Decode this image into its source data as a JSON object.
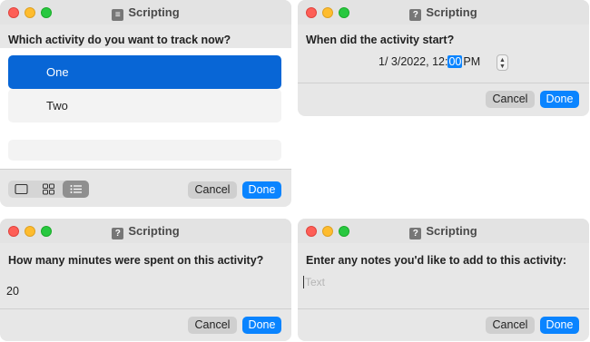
{
  "app_title": "Scripting",
  "title_icons": {
    "list": "list-icon",
    "question": "?"
  },
  "activity_dialog": {
    "prompt": "Which activity do you want to track now?",
    "items": [
      {
        "label": "One",
        "selected": true
      },
      {
        "label": "Two",
        "selected": false
      },
      {
        "label": "",
        "selected": false
      }
    ],
    "view_modes": [
      "single-view-icon",
      "grid-view-icon",
      "list-view-icon"
    ],
    "active_view": "list-view-icon",
    "cancel_label": "Cancel",
    "done_label": "Done"
  },
  "start_dialog": {
    "prompt": "When did the activity start?",
    "date_value": "1/  3/2022, 12:",
    "minute_value": "00",
    "ampm": "PM",
    "cancel_label": "Cancel",
    "done_label": "Done"
  },
  "minutes_dialog": {
    "prompt": "How many minutes were spent on this activity?",
    "input_value": "20",
    "cancel_label": "Cancel",
    "done_label": "Done"
  },
  "notes_dialog": {
    "prompt": "Enter any notes you'd like to add to this activity:",
    "placeholder": "Text",
    "cancel_label": "Cancel",
    "done_label": "Done"
  },
  "colors": {
    "accent": "#0a84ff",
    "selection": "#0866d6",
    "close": "#fe5f57",
    "minimize": "#febc2e",
    "zoom": "#28c840"
  }
}
